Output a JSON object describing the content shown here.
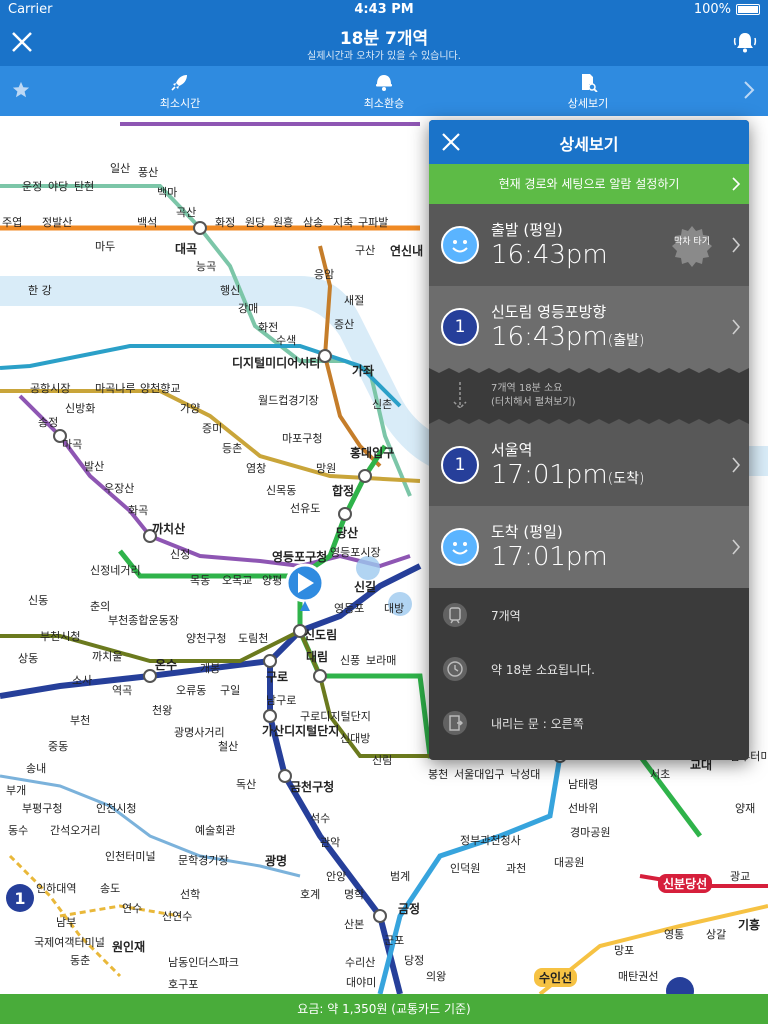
{
  "status_bar": {
    "carrier": "Carrier",
    "time": "4:43 PM",
    "battery": "100%"
  },
  "header": {
    "title": "18분 7개역",
    "subtitle": "실제시간과 오차가 있을 수 있습니다."
  },
  "tabs": [
    {
      "label": "최소시간"
    },
    {
      "label": "최소환승"
    },
    {
      "label": "상세보기"
    }
  ],
  "map": {
    "stations": [
      {
        "label": "일산"
      },
      {
        "label": "풍산"
      },
      {
        "label": "백마"
      },
      {
        "label": "운정"
      },
      {
        "label": "야당"
      },
      {
        "label": "탄현"
      },
      {
        "label": "곡산"
      },
      {
        "label": "주엽"
      },
      {
        "label": "정발산"
      },
      {
        "label": "마두"
      },
      {
        "label": "백석"
      },
      {
        "label": "대곡"
      },
      {
        "label": "화정"
      },
      {
        "label": "원당"
      },
      {
        "label": "원흥"
      },
      {
        "label": "삼송"
      },
      {
        "label": "지축"
      },
      {
        "label": "구파발"
      },
      {
        "label": "능곡"
      },
      {
        "label": "행신"
      },
      {
        "label": "강매"
      },
      {
        "label": "화전"
      },
      {
        "label": "수색"
      },
      {
        "label": "구산"
      },
      {
        "label": "연신내"
      },
      {
        "label": "응암"
      },
      {
        "label": "새절"
      },
      {
        "label": "증산"
      },
      {
        "label": "한 강"
      },
      {
        "label": "디지털미디어시티"
      },
      {
        "label": "공항시장"
      },
      {
        "label": "신방화"
      },
      {
        "label": "마곡나루"
      },
      {
        "label": "양천향교"
      },
      {
        "label": "가양"
      },
      {
        "label": "증미"
      },
      {
        "label": "등촌"
      },
      {
        "label": "염창"
      },
      {
        "label": "월드컵경기장"
      },
      {
        "label": "마포구청"
      },
      {
        "label": "망원"
      },
      {
        "label": "가좌"
      },
      {
        "label": "신촌"
      },
      {
        "label": "홍대입구"
      },
      {
        "label": "합정"
      },
      {
        "label": "당산"
      },
      {
        "label": "선유도"
      },
      {
        "label": "신목동"
      },
      {
        "label": "송정"
      },
      {
        "label": "마곡"
      },
      {
        "label": "발산"
      },
      {
        "label": "우장산"
      },
      {
        "label": "화곡"
      },
      {
        "label": "까치산"
      },
      {
        "label": "신정"
      },
      {
        "label": "신정네거리"
      },
      {
        "label": "목동"
      },
      {
        "label": "오목교"
      },
      {
        "label": "양평"
      },
      {
        "label": "영등포구청"
      },
      {
        "label": "영등포시장"
      },
      {
        "label": "신길"
      },
      {
        "label": "영등포"
      },
      {
        "label": "대방"
      },
      {
        "label": "신동"
      },
      {
        "label": "춘의"
      },
      {
        "label": "부천종합운동장"
      },
      {
        "label": "양천구청"
      },
      {
        "label": "도림천"
      },
      {
        "label": "신도림"
      },
      {
        "label": "부천시청"
      },
      {
        "label": "까치울"
      },
      {
        "label": "온수"
      },
      {
        "label": "개봉"
      },
      {
        "label": "구로"
      },
      {
        "label": "대림"
      },
      {
        "label": "신풍"
      },
      {
        "label": "보라매"
      },
      {
        "label": "상동"
      },
      {
        "label": "소사"
      },
      {
        "label": "역곡"
      },
      {
        "label": "오류동"
      },
      {
        "label": "구일"
      },
      {
        "label": "남구로"
      },
      {
        "label": "구로디지털단지"
      },
      {
        "label": "신대방"
      },
      {
        "label": "부천"
      },
      {
        "label": "천왕"
      },
      {
        "label": "광명사거리"
      },
      {
        "label": "철산"
      },
      {
        "label": "가산디지털단지"
      },
      {
        "label": "중동"
      },
      {
        "label": "송내"
      },
      {
        "label": "신림"
      },
      {
        "label": "봉천"
      },
      {
        "label": "서울대입구"
      },
      {
        "label": "낙성대"
      },
      {
        "label": "독산"
      },
      {
        "label": "금천구청"
      },
      {
        "label": "부개"
      },
      {
        "label": "부평구청"
      },
      {
        "label": "인천시청"
      },
      {
        "label": "석수"
      },
      {
        "label": "동수"
      },
      {
        "label": "간석오거리"
      },
      {
        "label": "예술회관"
      },
      {
        "label": "관악"
      },
      {
        "label": "정부과천청사"
      },
      {
        "label": "인천터미널"
      },
      {
        "label": "문학경기장"
      },
      {
        "label": "광명"
      },
      {
        "label": "안양"
      },
      {
        "label": "호계"
      },
      {
        "label": "범계"
      },
      {
        "label": "인덕원"
      },
      {
        "label": "과천"
      },
      {
        "label": "대공원"
      },
      {
        "label": "경마공원"
      },
      {
        "label": "서초"
      },
      {
        "label": "교대"
      },
      {
        "label": "남부터미널"
      },
      {
        "label": "양재"
      },
      {
        "label": "인하대역"
      },
      {
        "label": "송도"
      },
      {
        "label": "선학"
      },
      {
        "label": "명학"
      },
      {
        "label": "금정"
      },
      {
        "label": "남부"
      },
      {
        "label": "연수"
      },
      {
        "label": "신연수"
      },
      {
        "label": "산본"
      },
      {
        "label": "국제여객터미널"
      },
      {
        "label": "원인재"
      },
      {
        "label": "동춘"
      },
      {
        "label": "남동인더스파크"
      },
      {
        "label": "수리산"
      },
      {
        "label": "군포"
      },
      {
        "label": "당정"
      },
      {
        "label": "대야미"
      },
      {
        "label": "의왕"
      },
      {
        "label": "수인선"
      },
      {
        "label": "호구포"
      },
      {
        "label": "신분당선"
      },
      {
        "label": "광교"
      },
      {
        "label": "영통"
      },
      {
        "label": "상갈"
      },
      {
        "label": "기흥"
      },
      {
        "label": "망포"
      },
      {
        "label": "매탄권선"
      },
      {
        "label": "남태령"
      },
      {
        "label": "선바위"
      }
    ]
  },
  "panel": {
    "title": "상세보기",
    "alarm_label": "현재 경로와 세팅으로 알람 설정하기",
    "rows": [
      {
        "title": "출발 (평일)",
        "time": "16:43pm",
        "suffix": "",
        "icon": "smiley-icon",
        "badge": "막차 타기"
      },
      {
        "title": "신도림 영등포방향",
        "time": "16:43pm",
        "suffix": "(출발)",
        "icon": "line-1"
      },
      {
        "title": "서울역",
        "time": "17:01pm",
        "suffix": "(도착)",
        "icon": "line-1"
      },
      {
        "title": "도착 (평일)",
        "time": "17:01pm",
        "suffix": "",
        "icon": "smiley-icon"
      }
    ],
    "line_number": "1",
    "collapsed": {
      "line1": "7개역 18분 소요",
      "line2": "(터치해서 펼쳐보기)"
    },
    "info": [
      {
        "icon": "train-icon",
        "text": "7개역"
      },
      {
        "icon": "clock-icon",
        "text": "약 18분 소요됩니다."
      },
      {
        "icon": "door-icon",
        "text": "내리는 문 : 오른쪽"
      }
    ]
  },
  "fare": {
    "text": "요금: 약 1,350원 (교통카드 기준)"
  },
  "colors": {
    "primary": "#1a73c9",
    "tab_bar": "#2f8be0",
    "green": "#49ac3a",
    "line1": "#263f9a",
    "panel": "#3b3b3b"
  }
}
